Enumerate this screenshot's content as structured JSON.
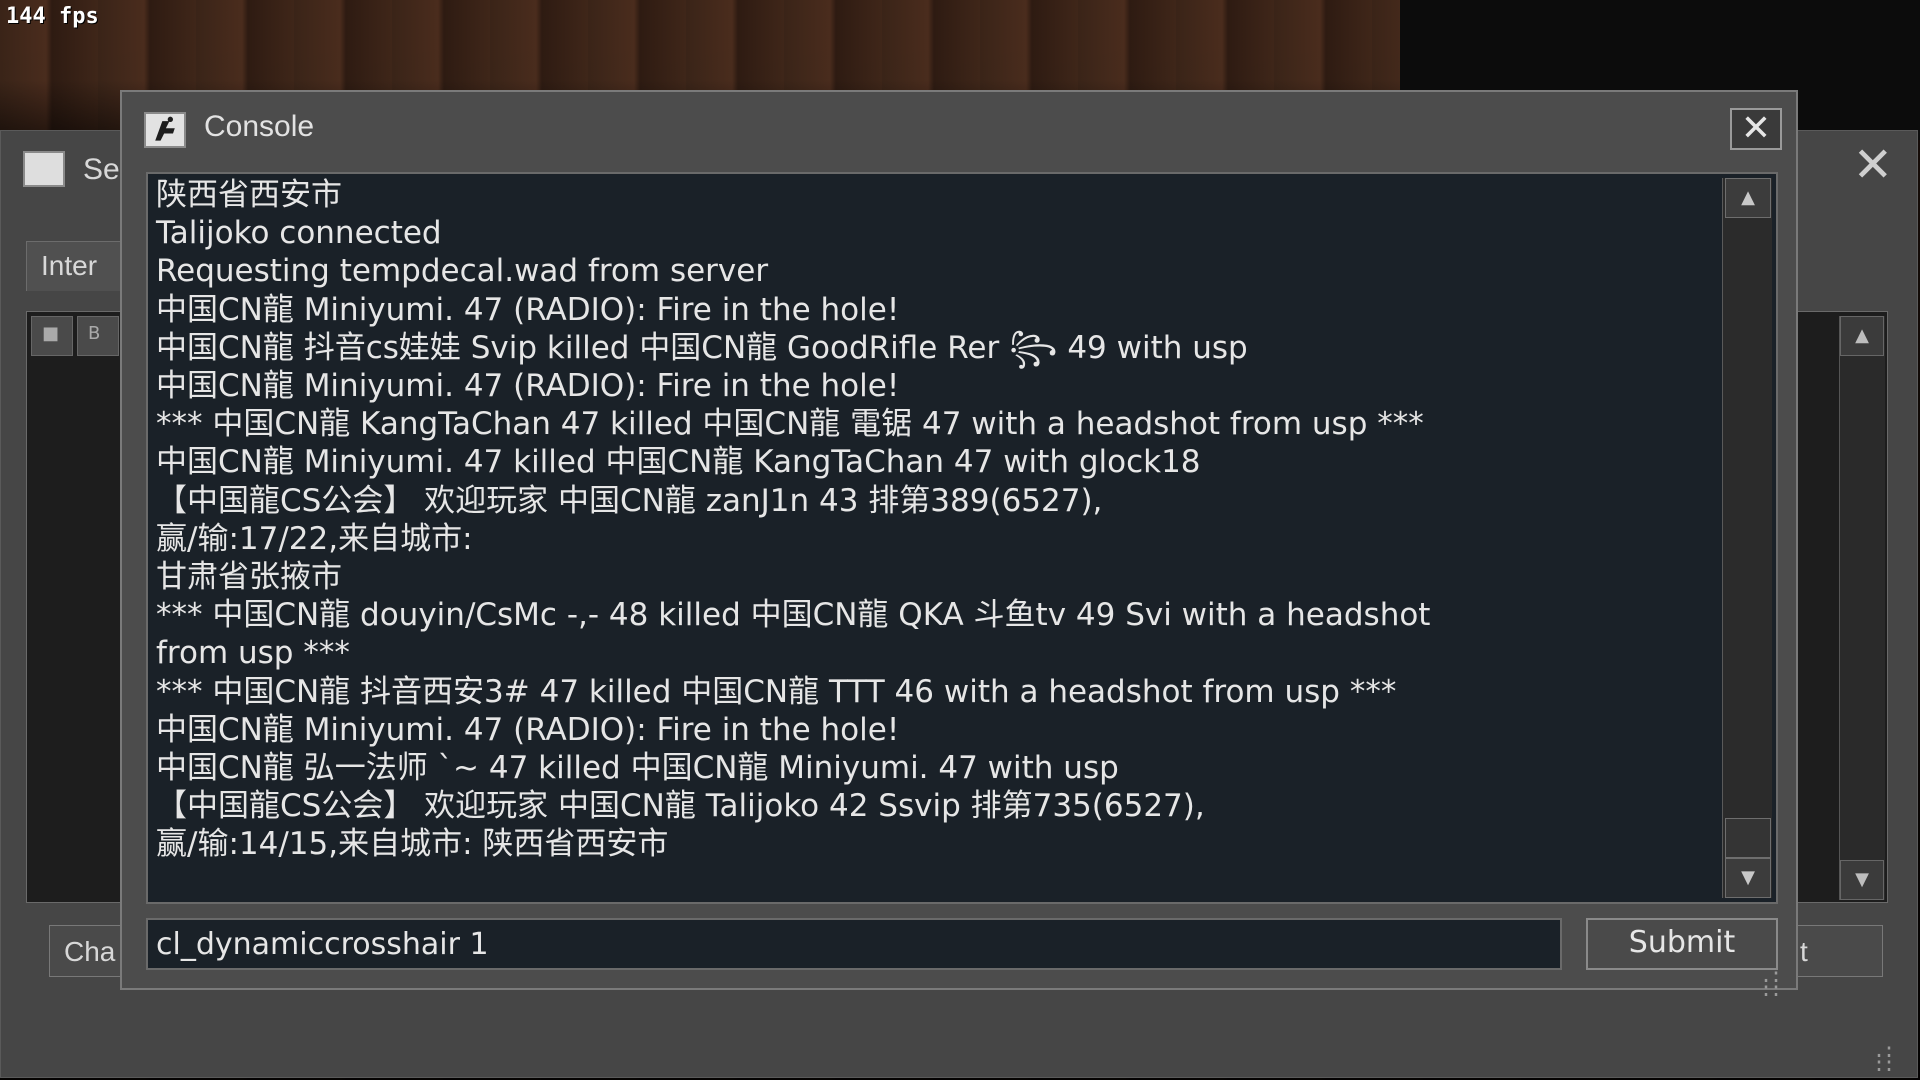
{
  "hud": {
    "fps": "144 fps"
  },
  "background_window": {
    "title": "Se",
    "tab_label": "Inter",
    "lock_col": "🔒",
    "b_col": "B",
    "left_button": "Cha",
    "right_button": "t"
  },
  "console": {
    "title": "Console",
    "log": [
      "陕西省西安市",
      "Talijoko connected",
      "Requesting tempdecal.wad from server",
      "中国CN龍 Miniyumi. 47 (RADIO): Fire in the hole!",
      "中国CN龍 抖音cs娃娃 Svip killed 中国CN龍 GoodRifle Rer ꧂ 49 with usp",
      "中国CN龍 Miniyumi. 47 (RADIO): Fire in the hole!",
      "*** 中国CN龍 KangTaChan 47 killed 中国CN龍 電锯 47 with a headshot from usp ***",
      "中国CN龍 Miniyumi. 47 killed 中国CN龍 KangTaChan 47 with glock18",
      "【中国龍CS公会】 欢迎玩家 中国CN龍 zanJ1n 43 排第389(6527),",
      "赢/输:17/22,来自城市:",
      "甘肃省张掖市",
      "*** 中国CN龍 douyin/CsMc -,- 48 killed 中国CN龍 QKA 斗鱼tv 49 Svi with a headshot",
      "from usp ***",
      "*** 中国CN龍 抖音西安3# 47 killed 中国CN龍 TTT 46 with a headshot from usp ***",
      "中国CN龍 Miniyumi. 47 (RADIO): Fire in the hole!",
      "中国CN龍 弘一法师 `~ 47 killed 中国CN龍 Miniyumi. 47 with usp",
      "【中国龍CS公会】 欢迎玩家 中国CN龍 Talijoko 42 Ssvip 排第735(6527),",
      "赢/输:14/15,来自城市: 陕西省西安市"
    ],
    "input_value": "cl_dynamiccrosshair 1",
    "submit_label": "Submit",
    "close_glyph": "✕",
    "icons": {
      "logo": "counter-strike-logo-icon",
      "close": "close-icon"
    }
  }
}
